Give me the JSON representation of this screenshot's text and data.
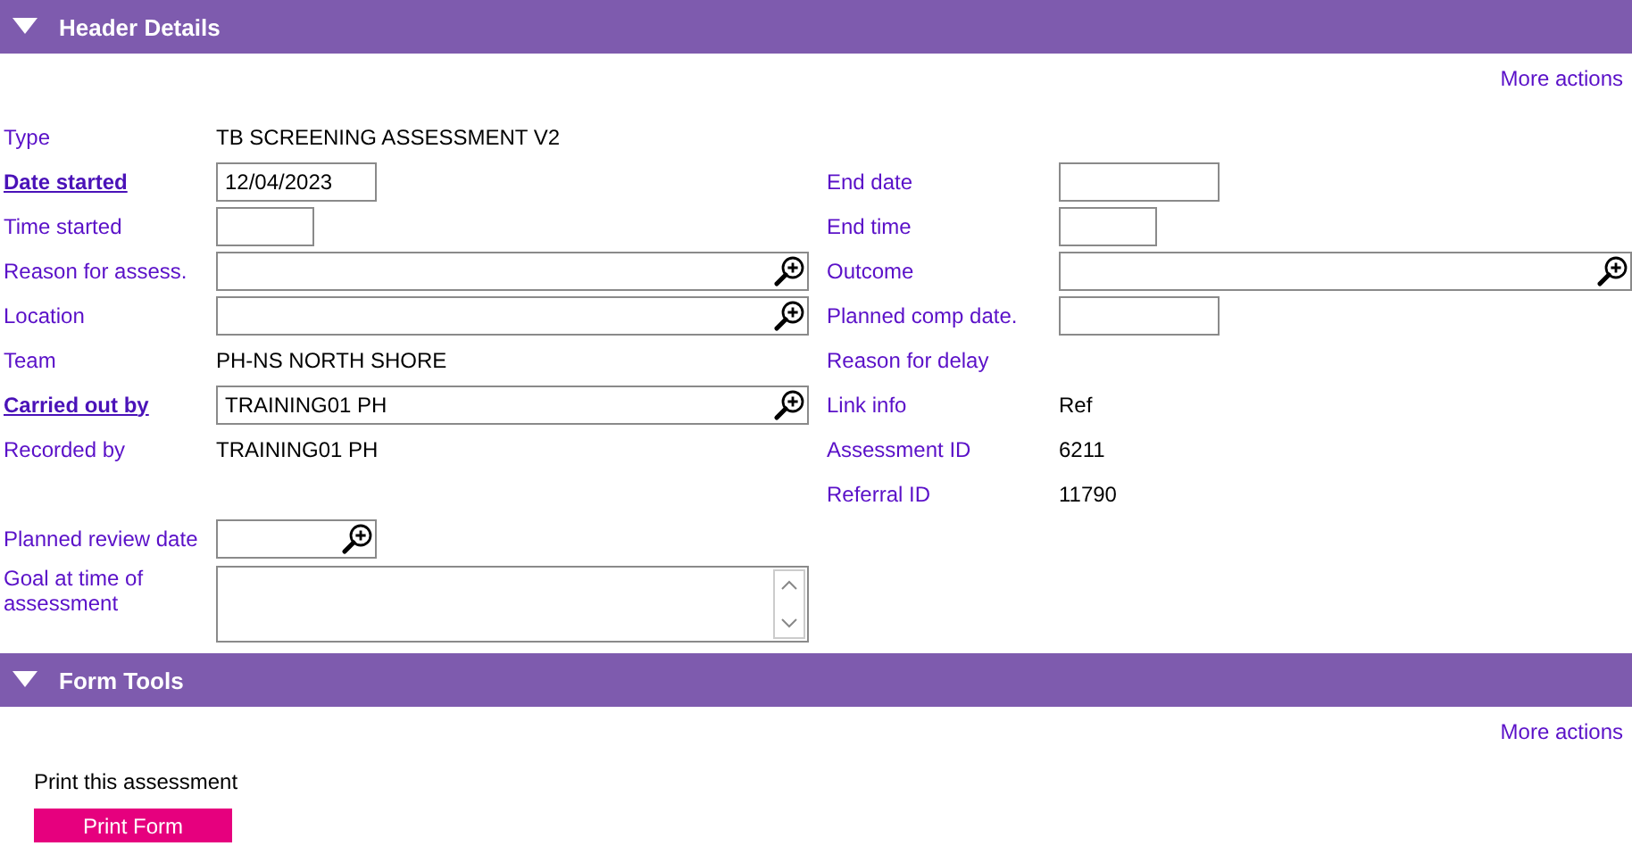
{
  "sections": [
    {
      "title": "Header Details",
      "expanded": true,
      "more_actions": "More actions",
      "left_fields": [
        {
          "label": "Type",
          "mandatory": false,
          "kind": "text",
          "value": "TB SCREENING ASSESSMENT V2"
        },
        {
          "label": "Date started",
          "mandatory": true,
          "kind": "date",
          "value": "12/04/2023"
        },
        {
          "label": "Time started",
          "mandatory": false,
          "kind": "time"
        },
        {
          "label": "Reason for assess.",
          "mandatory": false,
          "kind": "lookup"
        },
        {
          "label": "Location",
          "mandatory": false,
          "kind": "lookup"
        },
        {
          "label": "Team",
          "mandatory": false,
          "kind": "text",
          "value": "PH-NS NORTH SHORE"
        },
        {
          "label": "Carried out by",
          "mandatory": true,
          "kind": "lookup",
          "value": "TRAINING01 PH"
        },
        {
          "label": "Recorded by",
          "mandatory": false,
          "kind": "text",
          "value": "TRAINING01 PH"
        }
      ],
      "right_fields": [
        {
          "label": "End date",
          "mandatory": false,
          "kind": "date"
        },
        {
          "label": "End time",
          "mandatory": false,
          "kind": "time"
        },
        {
          "label": "Outcome",
          "mandatory": false,
          "kind": "lookup"
        },
        {
          "label": "Planned comp date.",
          "mandatory": false,
          "kind": "date"
        },
        {
          "label": "Reason for delay",
          "mandatory": false,
          "kind": "none"
        },
        {
          "label": "Link info",
          "mandatory": false,
          "kind": "text",
          "value": "Ref"
        },
        {
          "label": "Assessment ID",
          "mandatory": false,
          "kind": "text",
          "value": "6211"
        },
        {
          "label": "Referral ID",
          "mandatory": false,
          "kind": "text",
          "value": "11790"
        }
      ],
      "extra_fields": [
        {
          "label": "Planned review date",
          "mandatory": false,
          "kind": "date-lookup"
        },
        {
          "label": "Goal at time of assessment",
          "mandatory": false,
          "kind": "textarea"
        }
      ]
    },
    {
      "title": "Form Tools",
      "expanded": true,
      "more_actions": "More actions",
      "print_label": "Print this assessment",
      "print_button": "Print Form"
    }
  ]
}
